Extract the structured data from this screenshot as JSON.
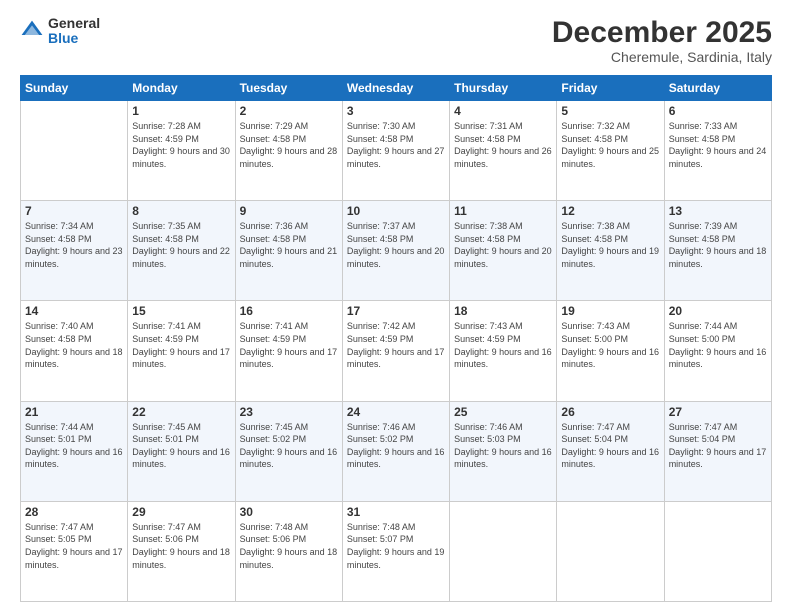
{
  "logo": {
    "general": "General",
    "blue": "Blue"
  },
  "header": {
    "month": "December 2025",
    "location": "Cheremule, Sardinia, Italy"
  },
  "weekdays": [
    "Sunday",
    "Monday",
    "Tuesday",
    "Wednesday",
    "Thursday",
    "Friday",
    "Saturday"
  ],
  "weeks": [
    [
      {
        "day": "",
        "sunrise": "",
        "sunset": "",
        "daylight": ""
      },
      {
        "day": "1",
        "sunrise": "Sunrise: 7:28 AM",
        "sunset": "Sunset: 4:59 PM",
        "daylight": "Daylight: 9 hours and 30 minutes."
      },
      {
        "day": "2",
        "sunrise": "Sunrise: 7:29 AM",
        "sunset": "Sunset: 4:58 PM",
        "daylight": "Daylight: 9 hours and 28 minutes."
      },
      {
        "day": "3",
        "sunrise": "Sunrise: 7:30 AM",
        "sunset": "Sunset: 4:58 PM",
        "daylight": "Daylight: 9 hours and 27 minutes."
      },
      {
        "day": "4",
        "sunrise": "Sunrise: 7:31 AM",
        "sunset": "Sunset: 4:58 PM",
        "daylight": "Daylight: 9 hours and 26 minutes."
      },
      {
        "day": "5",
        "sunrise": "Sunrise: 7:32 AM",
        "sunset": "Sunset: 4:58 PM",
        "daylight": "Daylight: 9 hours and 25 minutes."
      },
      {
        "day": "6",
        "sunrise": "Sunrise: 7:33 AM",
        "sunset": "Sunset: 4:58 PM",
        "daylight": "Daylight: 9 hours and 24 minutes."
      }
    ],
    [
      {
        "day": "7",
        "sunrise": "Sunrise: 7:34 AM",
        "sunset": "Sunset: 4:58 PM",
        "daylight": "Daylight: 9 hours and 23 minutes."
      },
      {
        "day": "8",
        "sunrise": "Sunrise: 7:35 AM",
        "sunset": "Sunset: 4:58 PM",
        "daylight": "Daylight: 9 hours and 22 minutes."
      },
      {
        "day": "9",
        "sunrise": "Sunrise: 7:36 AM",
        "sunset": "Sunset: 4:58 PM",
        "daylight": "Daylight: 9 hours and 21 minutes."
      },
      {
        "day": "10",
        "sunrise": "Sunrise: 7:37 AM",
        "sunset": "Sunset: 4:58 PM",
        "daylight": "Daylight: 9 hours and 20 minutes."
      },
      {
        "day": "11",
        "sunrise": "Sunrise: 7:38 AM",
        "sunset": "Sunset: 4:58 PM",
        "daylight": "Daylight: 9 hours and 20 minutes."
      },
      {
        "day": "12",
        "sunrise": "Sunrise: 7:38 AM",
        "sunset": "Sunset: 4:58 PM",
        "daylight": "Daylight: 9 hours and 19 minutes."
      },
      {
        "day": "13",
        "sunrise": "Sunrise: 7:39 AM",
        "sunset": "Sunset: 4:58 PM",
        "daylight": "Daylight: 9 hours and 18 minutes."
      }
    ],
    [
      {
        "day": "14",
        "sunrise": "Sunrise: 7:40 AM",
        "sunset": "Sunset: 4:58 PM",
        "daylight": "Daylight: 9 hours and 18 minutes."
      },
      {
        "day": "15",
        "sunrise": "Sunrise: 7:41 AM",
        "sunset": "Sunset: 4:59 PM",
        "daylight": "Daylight: 9 hours and 17 minutes."
      },
      {
        "day": "16",
        "sunrise": "Sunrise: 7:41 AM",
        "sunset": "Sunset: 4:59 PM",
        "daylight": "Daylight: 9 hours and 17 minutes."
      },
      {
        "day": "17",
        "sunrise": "Sunrise: 7:42 AM",
        "sunset": "Sunset: 4:59 PM",
        "daylight": "Daylight: 9 hours and 17 minutes."
      },
      {
        "day": "18",
        "sunrise": "Sunrise: 7:43 AM",
        "sunset": "Sunset: 4:59 PM",
        "daylight": "Daylight: 9 hours and 16 minutes."
      },
      {
        "day": "19",
        "sunrise": "Sunrise: 7:43 AM",
        "sunset": "Sunset: 5:00 PM",
        "daylight": "Daylight: 9 hours and 16 minutes."
      },
      {
        "day": "20",
        "sunrise": "Sunrise: 7:44 AM",
        "sunset": "Sunset: 5:00 PM",
        "daylight": "Daylight: 9 hours and 16 minutes."
      }
    ],
    [
      {
        "day": "21",
        "sunrise": "Sunrise: 7:44 AM",
        "sunset": "Sunset: 5:01 PM",
        "daylight": "Daylight: 9 hours and 16 minutes."
      },
      {
        "day": "22",
        "sunrise": "Sunrise: 7:45 AM",
        "sunset": "Sunset: 5:01 PM",
        "daylight": "Daylight: 9 hours and 16 minutes."
      },
      {
        "day": "23",
        "sunrise": "Sunrise: 7:45 AM",
        "sunset": "Sunset: 5:02 PM",
        "daylight": "Daylight: 9 hours and 16 minutes."
      },
      {
        "day": "24",
        "sunrise": "Sunrise: 7:46 AM",
        "sunset": "Sunset: 5:02 PM",
        "daylight": "Daylight: 9 hours and 16 minutes."
      },
      {
        "day": "25",
        "sunrise": "Sunrise: 7:46 AM",
        "sunset": "Sunset: 5:03 PM",
        "daylight": "Daylight: 9 hours and 16 minutes."
      },
      {
        "day": "26",
        "sunrise": "Sunrise: 7:47 AM",
        "sunset": "Sunset: 5:04 PM",
        "daylight": "Daylight: 9 hours and 16 minutes."
      },
      {
        "day": "27",
        "sunrise": "Sunrise: 7:47 AM",
        "sunset": "Sunset: 5:04 PM",
        "daylight": "Daylight: 9 hours and 17 minutes."
      }
    ],
    [
      {
        "day": "28",
        "sunrise": "Sunrise: 7:47 AM",
        "sunset": "Sunset: 5:05 PM",
        "daylight": "Daylight: 9 hours and 17 minutes."
      },
      {
        "day": "29",
        "sunrise": "Sunrise: 7:47 AM",
        "sunset": "Sunset: 5:06 PM",
        "daylight": "Daylight: 9 hours and 18 minutes."
      },
      {
        "day": "30",
        "sunrise": "Sunrise: 7:48 AM",
        "sunset": "Sunset: 5:06 PM",
        "daylight": "Daylight: 9 hours and 18 minutes."
      },
      {
        "day": "31",
        "sunrise": "Sunrise: 7:48 AM",
        "sunset": "Sunset: 5:07 PM",
        "daylight": "Daylight: 9 hours and 19 minutes."
      },
      {
        "day": "",
        "sunrise": "",
        "sunset": "",
        "daylight": ""
      },
      {
        "day": "",
        "sunrise": "",
        "sunset": "",
        "daylight": ""
      },
      {
        "day": "",
        "sunrise": "",
        "sunset": "",
        "daylight": ""
      }
    ]
  ]
}
